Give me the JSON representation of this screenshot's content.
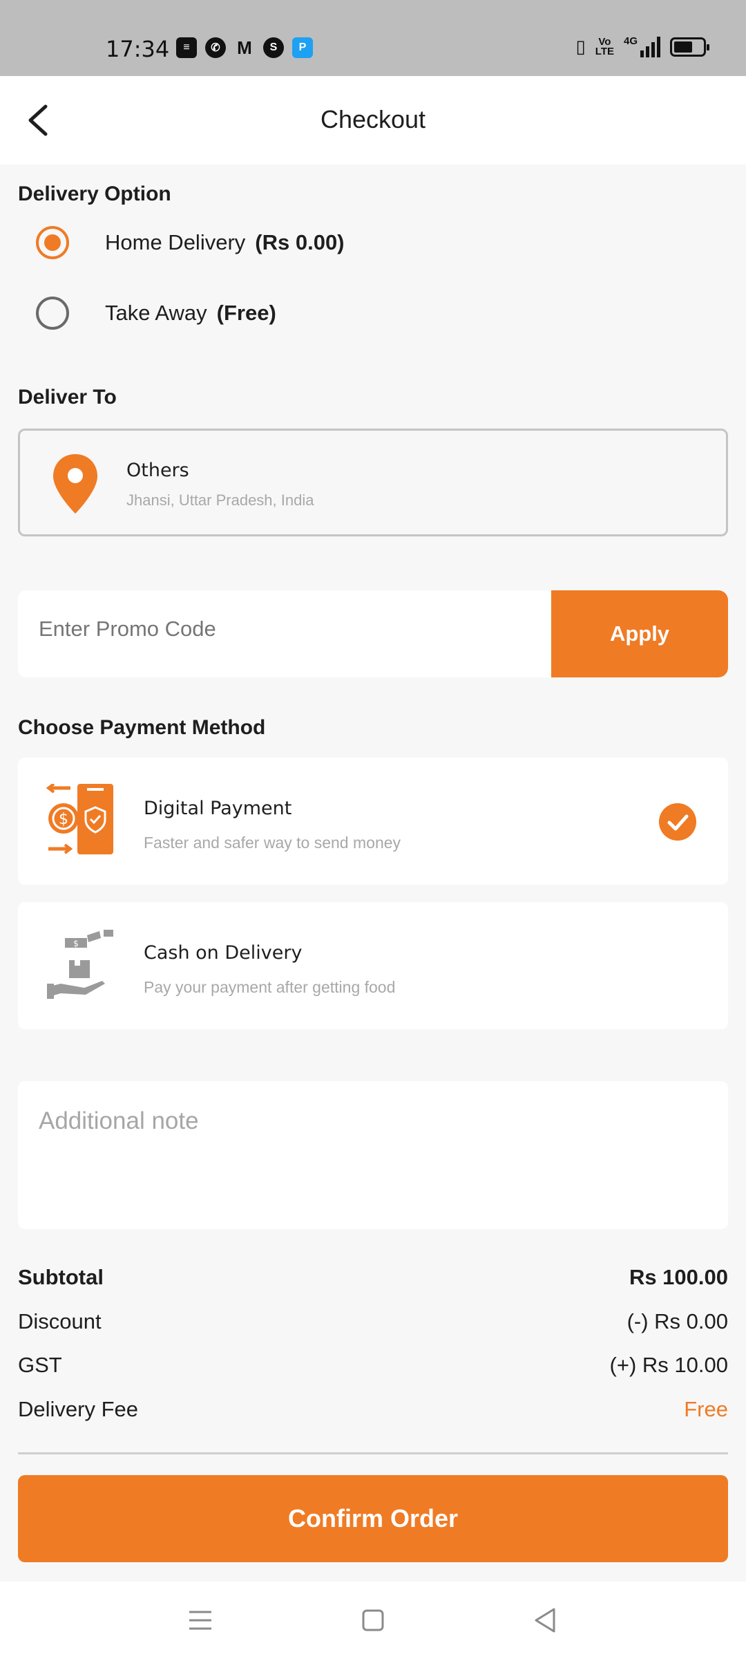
{
  "status_bar": {
    "time": "17:34",
    "notification_icons": [
      "message-icon",
      "whatsapp-icon",
      "gmail-icon",
      "skype-icon",
      "p-app-icon"
    ],
    "network_label_top": "Vo",
    "network_label_bottom": "LTE",
    "network_type": "4G"
  },
  "header": {
    "title": "Checkout"
  },
  "delivery_option": {
    "heading": "Delivery Option",
    "options": [
      {
        "label": "Home Delivery",
        "price": "(Rs 0.00)",
        "selected": true
      },
      {
        "label": "Take Away",
        "price": "(Free)",
        "selected": false
      }
    ]
  },
  "deliver_to": {
    "heading": "Deliver To",
    "address_name": "Others",
    "address_line": "Jhansi, Uttar Pradesh, India"
  },
  "promo": {
    "placeholder": "Enter Promo Code",
    "apply_label": "Apply"
  },
  "payment": {
    "heading": "Choose Payment Method",
    "methods": [
      {
        "title": "Digital Payment",
        "subtitle": "Faster and safer way to send money",
        "selected": true,
        "icon": "digital-payment-icon"
      },
      {
        "title": "Cash on Delivery",
        "subtitle": "Pay your payment after getting food",
        "selected": false,
        "icon": "cash-on-delivery-icon"
      }
    ]
  },
  "note": {
    "placeholder": "Additional note"
  },
  "summary": {
    "rows": [
      {
        "label": "Subtotal",
        "value": "Rs 100.00"
      },
      {
        "label": "Discount",
        "value": "(-) Rs 0.00"
      },
      {
        "label": "GST",
        "value": "(+) Rs 10.00"
      },
      {
        "label": "Delivery Fee",
        "value": "Free"
      }
    ]
  },
  "confirm_label": "Confirm Order",
  "colors": {
    "accent": "#ef7b25",
    "status_bar": "#bdbdbd",
    "background": "#f7f7f7"
  }
}
